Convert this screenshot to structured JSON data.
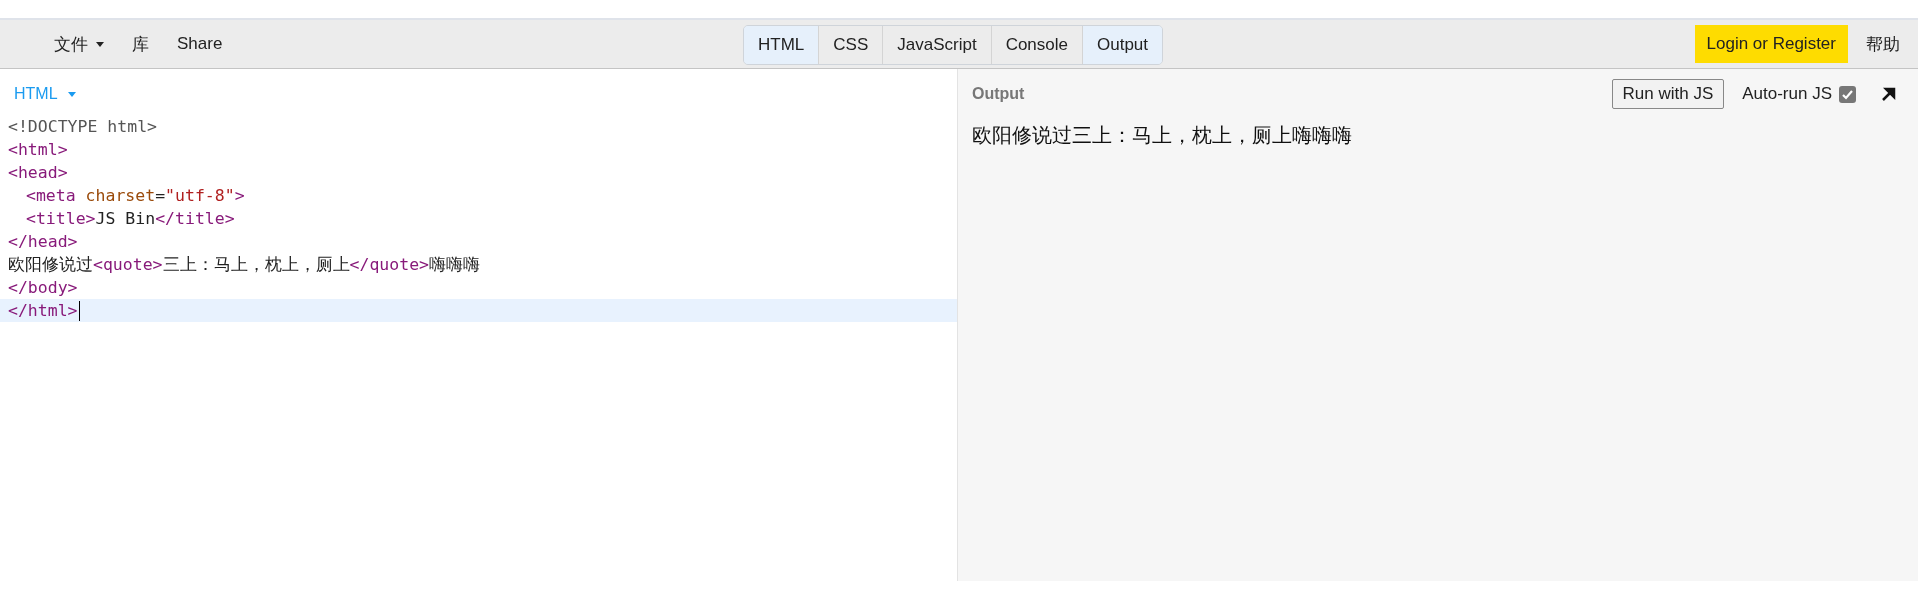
{
  "menu": [
    {
      "label": "文件",
      "dropdown": true
    },
    {
      "label": "库",
      "dropdown": false
    },
    {
      "label": "Share",
      "dropdown": false
    }
  ],
  "panel_tabs": [
    {
      "label": "HTML",
      "selected": true
    },
    {
      "label": "CSS",
      "selected": false
    },
    {
      "label": "JavaScript",
      "selected": false
    },
    {
      "label": "Console",
      "selected": false
    },
    {
      "label": "Output",
      "selected": true
    }
  ],
  "login_button": "Login or Register",
  "help_link": "帮助",
  "editor": {
    "language": "HTML",
    "lines": [
      {
        "active": false,
        "tokens": [
          {
            "kind": "doctype",
            "text": "<!DOCTYPE html>"
          }
        ]
      },
      {
        "active": false,
        "tokens": [
          {
            "kind": "tag",
            "text": "<html>"
          }
        ]
      },
      {
        "active": false,
        "tokens": [
          {
            "kind": "tag",
            "text": "<head>"
          }
        ]
      },
      {
        "active": false,
        "indent": true,
        "tokens": [
          {
            "kind": "tag",
            "text": "<meta "
          },
          {
            "kind": "attr",
            "text": "charset"
          },
          {
            "kind": "text",
            "text": "="
          },
          {
            "kind": "string",
            "text": "\"utf-8\""
          },
          {
            "kind": "tag",
            "text": ">"
          }
        ]
      },
      {
        "active": false,
        "indent": true,
        "tokens": [
          {
            "kind": "tag",
            "text": "<title>"
          },
          {
            "kind": "text",
            "text": "JS Bin"
          },
          {
            "kind": "tag",
            "text": "</title>"
          }
        ]
      },
      {
        "active": false,
        "tokens": [
          {
            "kind": "tag",
            "text": "</head>"
          }
        ]
      },
      {
        "active": false,
        "tokens": [
          {
            "kind": "text",
            "text": "欧阳修说过"
          },
          {
            "kind": "tag",
            "text": "<quote>"
          },
          {
            "kind": "text",
            "text": "三上：马上，枕上，厕上"
          },
          {
            "kind": "tag",
            "text": "</quote>"
          },
          {
            "kind": "text",
            "text": "嗨嗨嗨"
          }
        ]
      },
      {
        "active": false,
        "tokens": [
          {
            "kind": "tag",
            "text": "</body>"
          }
        ]
      },
      {
        "active": true,
        "tokens": [
          {
            "kind": "tag",
            "text": "</html>"
          }
        ]
      }
    ]
  },
  "output": {
    "title": "Output",
    "run_button": "Run with JS",
    "autorun_label": "Auto-run JS",
    "autorun_checked": true,
    "content": "欧阳修说过三上：马上，枕上，厕上嗨嗨嗨"
  }
}
